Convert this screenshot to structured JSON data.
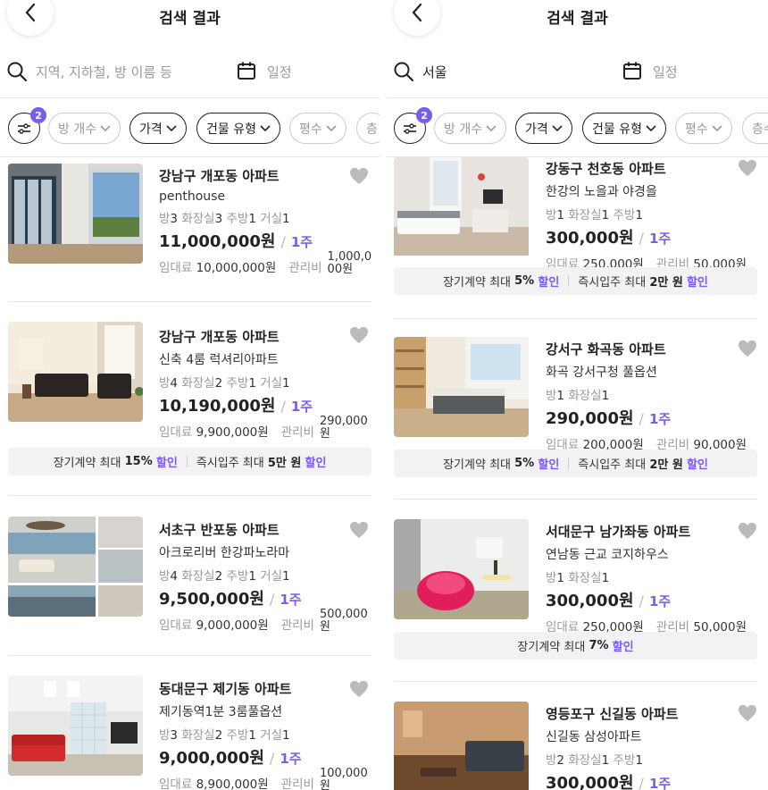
{
  "header": {
    "title": "검색 결과"
  },
  "left": {
    "search_placeholder": "지역, 지하철, 방 이름 등",
    "schedule_placeholder": "일정",
    "filter_badge": "2",
    "filters": [
      "방 개수",
      "가격",
      "건물 유형",
      "평수",
      "층"
    ],
    "listings": [
      {
        "title": "강남구 개포동 아파트",
        "subtitle": "penthouse",
        "rooms": [
          [
            "방",
            "3"
          ],
          [
            "화장실",
            "3"
          ],
          [
            "주방",
            "1"
          ],
          [
            "거실",
            "1"
          ]
        ],
        "price": "11,000,000원",
        "period": "1주",
        "rent_label": "임대료",
        "rent": "10,000,000원",
        "mgmt_label": "관리비",
        "mgmt": "1,000,000원"
      },
      {
        "title": "강남구 개포동 아파트",
        "subtitle": "신축 4룸 럭셔리아파트",
        "rooms": [
          [
            "방",
            "4"
          ],
          [
            "화장실",
            "2"
          ],
          [
            "주방",
            "1"
          ],
          [
            "거실",
            "1"
          ]
        ],
        "price": "10,190,000원",
        "period": "1주",
        "rent_label": "임대료",
        "rent": "9,900,000원",
        "mgmt_label": "관리비",
        "mgmt": "290,000원",
        "discount": {
          "a": "장기계약 최대",
          "b": "15%",
          "c": "할인",
          "d": "즉시입주 최대",
          "e": "5만 원",
          "f": "할인"
        }
      },
      {
        "title": "서초구 반포동 아파트",
        "subtitle": "아크로리버 한강파노라마",
        "rooms": [
          [
            "방",
            "4"
          ],
          [
            "화장실",
            "2"
          ],
          [
            "주방",
            "1"
          ],
          [
            "거실",
            "1"
          ]
        ],
        "price": "9,500,000원",
        "period": "1주",
        "rent_label": "임대료",
        "rent": "9,000,000원",
        "mgmt_label": "관리비",
        "mgmt": "500,000원"
      },
      {
        "title": "동대문구 제기동 아파트",
        "subtitle": "제기동역1분 3룸풀옵션",
        "rooms": [
          [
            "방",
            "3"
          ],
          [
            "화장실",
            "2"
          ],
          [
            "주방",
            "1"
          ],
          [
            "거실",
            "1"
          ]
        ],
        "price": "9,000,000원",
        "period": "1주",
        "rent_label": "임대료",
        "rent": "8,900,000원",
        "mgmt_label": "관리비",
        "mgmt": "100,000원"
      }
    ]
  },
  "right": {
    "search_value": "서울",
    "schedule_placeholder": "일정",
    "filter_badge": "2",
    "filters": [
      "방 개수",
      "가격",
      "건물 유형",
      "평수",
      "층수"
    ],
    "listings": [
      {
        "title": "강동구 천호동 아파트",
        "subtitle": "한강의 노을과 야경을",
        "rooms": [
          [
            "방",
            "1"
          ],
          [
            "화장실",
            "1"
          ],
          [
            "주방",
            "1"
          ]
        ],
        "price": "300,000원",
        "period": "1주",
        "rent_label": "임대료",
        "rent": "250,000원",
        "mgmt_label": "관리비",
        "mgmt": "50,000원",
        "discount": {
          "a": "장기계약 최대",
          "b": "5%",
          "c": "할인",
          "d": "즉시입주 최대",
          "e": "2만 원",
          "f": "할인"
        }
      },
      {
        "title": "강서구 화곡동 아파트",
        "subtitle": "화곡 강서구청 풀옵션",
        "rooms": [
          [
            "방",
            "1"
          ],
          [
            "화장실",
            "1"
          ]
        ],
        "price": "290,000원",
        "period": "1주",
        "rent_label": "임대료",
        "rent": "200,000원",
        "mgmt_label": "관리비",
        "mgmt": "90,000원",
        "discount": {
          "a": "장기계약 최대",
          "b": "5%",
          "c": "할인",
          "d": "즉시입주 최대",
          "e": "2만 원",
          "f": "할인"
        }
      },
      {
        "title": "서대문구 남가좌동 아파트",
        "subtitle": "연남동 근교 코지하우스",
        "rooms": [
          [
            "방",
            "1"
          ],
          [
            "화장실",
            "1"
          ]
        ],
        "price": "300,000원",
        "period": "1주",
        "rent_label": "임대료",
        "rent": "250,000원",
        "mgmt_label": "관리비",
        "mgmt": "50,000원",
        "discount": {
          "a": "장기계약 최대",
          "b": "7%",
          "c": "할인"
        }
      },
      {
        "title": "영등포구 신길동 아파트",
        "subtitle": "신길동 삼성아파트",
        "rooms": [
          [
            "방",
            "2"
          ],
          [
            "화장실",
            "1"
          ],
          [
            "주방",
            "1"
          ]
        ],
        "price": "300,000원",
        "period": "1주"
      }
    ]
  },
  "colors": {
    "accent": "#7b5cf0",
    "heart": "#bbb"
  }
}
